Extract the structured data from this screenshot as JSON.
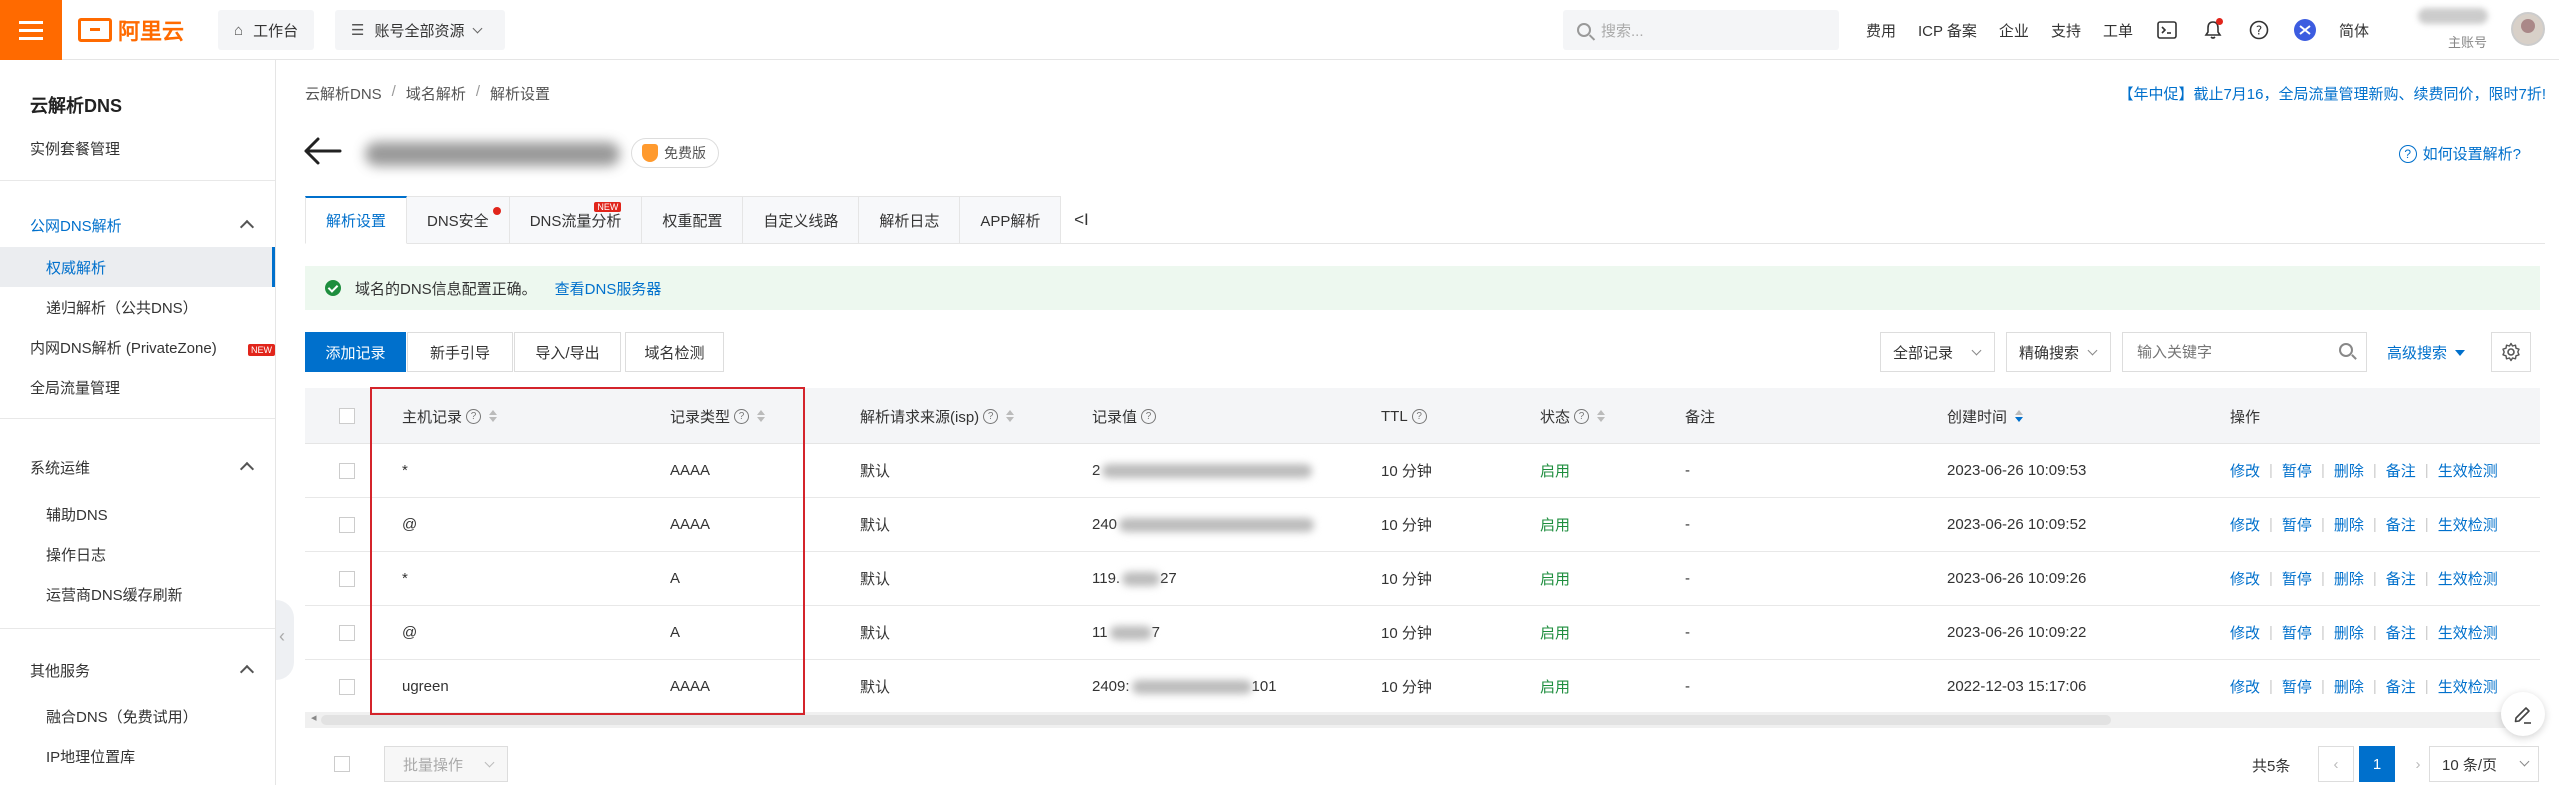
{
  "topbar": {
    "logo": "阿里云",
    "workbench": "工作台",
    "resources": "账号全部资源",
    "search_placeholder": "搜索...",
    "links": [
      "费用",
      "ICP 备案",
      "企业",
      "支持",
      "工单"
    ],
    "lang": "简体",
    "account_sub": "主账号"
  },
  "sidebar": {
    "title": "云解析DNS",
    "items": {
      "instance": "实例套餐管理",
      "public_dns": "公网DNS解析",
      "authoritative": "权威解析",
      "recursive": "递归解析（公共DNS）",
      "privatezone": "内网DNS解析 (PrivateZone)",
      "privatezone_badge": "NEW",
      "gtm": "全局流量管理",
      "ops": "系统运维",
      "assist": "辅助DNS",
      "oplog": "操作日志",
      "isp_refresh": "运营商DNS缓存刷新",
      "other": "其他服务",
      "fusion": "融合DNS（免费试用）",
      "ipgeo": "IP地理位置库"
    }
  },
  "breadcrumb": [
    "云解析DNS",
    "域名解析",
    "解析设置"
  ],
  "promo": "【年中促】截止7月16，全局流量管理新购、续费同价，限时7折!",
  "domain": {
    "edition": "免费版",
    "howto": "如何设置解析?"
  },
  "tabs": [
    {
      "label": "解析设置",
      "active": true
    },
    {
      "label": "DNS安全",
      "dot": true
    },
    {
      "label": "DNS流量分析",
      "badge": "NEW"
    },
    {
      "label": "权重配置"
    },
    {
      "label": "自定义线路"
    },
    {
      "label": "解析日志"
    },
    {
      "label": "APP解析"
    }
  ],
  "tab_collapse": "<I",
  "alert": {
    "text": "域名的DNS信息配置正确。",
    "link": "查看DNS服务器"
  },
  "toolbar": {
    "add": "添加记录",
    "guide": "新手引导",
    "import_export": "导入/导出",
    "check": "域名检测",
    "filter": "全部记录",
    "search_mode": "精确搜索",
    "keyword_placeholder": "输入关键字",
    "advanced": "高级搜索"
  },
  "table": {
    "headers": {
      "host": "主机记录",
      "type": "记录类型",
      "isp": "解析请求来源(isp)",
      "value": "记录值",
      "ttl": "TTL",
      "status": "状态",
      "remark": "备注",
      "created": "创建时间",
      "actions": "操作"
    },
    "actions": [
      "修改",
      "暂停",
      "删除",
      "备注",
      "生效检测"
    ],
    "rows": [
      {
        "host": "*",
        "type": "AAAA",
        "isp": "默认",
        "value_prefix": "2",
        "value_suffix": "",
        "ttl": "10 分钟",
        "status": "启用",
        "remark": "-",
        "created": "2023-06-26 10:09:53"
      },
      {
        "host": "@",
        "type": "AAAA",
        "isp": "默认",
        "value_prefix": "240",
        "value_suffix": "",
        "ttl": "10 分钟",
        "status": "启用",
        "remark": "-",
        "created": "2023-06-26 10:09:52"
      },
      {
        "host": "*",
        "type": "A",
        "isp": "默认",
        "value_prefix": "119.",
        "value_suffix": "27",
        "ttl": "10 分钟",
        "status": "启用",
        "remark": "-",
        "created": "2023-06-26 10:09:26"
      },
      {
        "host": "@",
        "type": "A",
        "isp": "默认",
        "value_prefix": "11",
        "value_suffix": "7",
        "ttl": "10 分钟",
        "status": "启用",
        "remark": "-",
        "created": "2023-06-26 10:09:22"
      },
      {
        "host": "ugreen",
        "type": "AAAA",
        "isp": "默认",
        "value_prefix": "2409:",
        "value_suffix": "101",
        "ttl": "10 分钟",
        "status": "启用",
        "remark": "-",
        "created": "2022-12-03 15:17:06"
      }
    ]
  },
  "footer": {
    "batch": "批量操作",
    "total": "共5条",
    "page": "1",
    "page_size": "10 条/页"
  },
  "colors": {
    "brand": "#ff6a00",
    "primary": "#0070cc",
    "success": "#1e8e3e",
    "highlight": "#d4242b"
  }
}
